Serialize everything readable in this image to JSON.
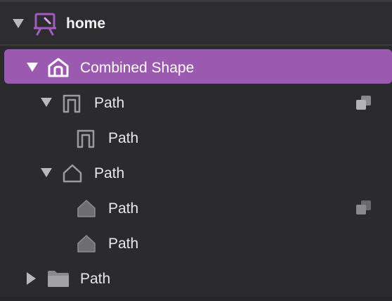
{
  "layers": {
    "artboard": {
      "label": "home",
      "icon": "artboard-icon"
    },
    "combined": {
      "label": "Combined Shape",
      "icon": "home-shape-icon",
      "selected_color": "#9b59b0"
    },
    "path_group_1": {
      "label": "Path",
      "icon": "arch-path-icon"
    },
    "path_group_1_child": {
      "label": "Path",
      "icon": "arch-path-icon"
    },
    "path_group_2": {
      "label": "Path",
      "icon": "house-outline-icon"
    },
    "path_group_2_child_1": {
      "label": "Path",
      "icon": "house-filled-icon"
    },
    "path_group_2_child_2": {
      "label": "Path",
      "icon": "house-filled-icon"
    },
    "folder": {
      "label": "Path",
      "icon": "folder-icon"
    }
  }
}
